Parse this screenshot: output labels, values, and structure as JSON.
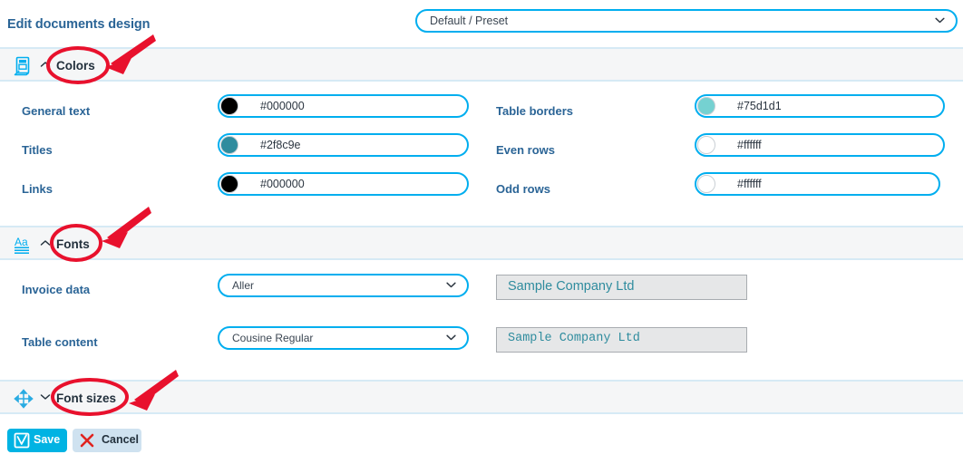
{
  "header": {
    "title": "Edit documents design",
    "preset_select": {
      "value": "Default / Preset",
      "icon": "chevron-down-icon"
    }
  },
  "sections": [
    {
      "id": "colors",
      "label": "Colors",
      "icon": "document-design-icon",
      "caret": "chevron-up-icon",
      "annotated": true
    },
    {
      "id": "fonts",
      "label": "Fonts",
      "icon": "font-aa-icon",
      "caret": "chevron-up-icon",
      "annotated": true
    },
    {
      "id": "font-sizes",
      "label": "Font sizes",
      "icon": "resize-arrows-icon",
      "caret": "chevron-down-icon",
      "annotated": true
    }
  ],
  "colors": {
    "left_column": [
      {
        "label": "General text",
        "value": "#000000",
        "swatch": "#000000"
      },
      {
        "label": "Titles",
        "value": "#2f8c9e",
        "swatch": "#2f8c9e"
      },
      {
        "label": "Links",
        "value": "#000000",
        "swatch": "#000000"
      }
    ],
    "right_column": [
      {
        "label": "Table borders",
        "value": "#75d1d1",
        "swatch": "#75d1d1"
      },
      {
        "label": "Even rows",
        "value": "#ffffff",
        "swatch": "#ffffff"
      },
      {
        "label": "Odd rows",
        "value": "#ffffff",
        "swatch": "#ffffff"
      }
    ]
  },
  "fonts": {
    "rows": [
      {
        "label": "Invoice data",
        "font": "Aller",
        "sample": "Sample Company Ltd"
      },
      {
        "label": "Table content",
        "font": "Cousine Regular",
        "sample": "Sample Company Ltd"
      }
    ]
  },
  "footer": {
    "save_label": "Save",
    "save_icon": "checkbox-check-icon",
    "cancel_label": "Cancel",
    "cancel_icon": "close-x-icon"
  },
  "theme": {
    "accent": "#00aeef",
    "label_blue": "#2a6496",
    "band_bg": "#f5f6f7",
    "band_border": "#d6eaf5",
    "annotation_red": "#e8112d",
    "save_bg": "#00b3e3",
    "cancel_bg": "#cfe2f0",
    "sample_text": "#2f8c9e",
    "sample_bg": "#e6e7e8"
  }
}
